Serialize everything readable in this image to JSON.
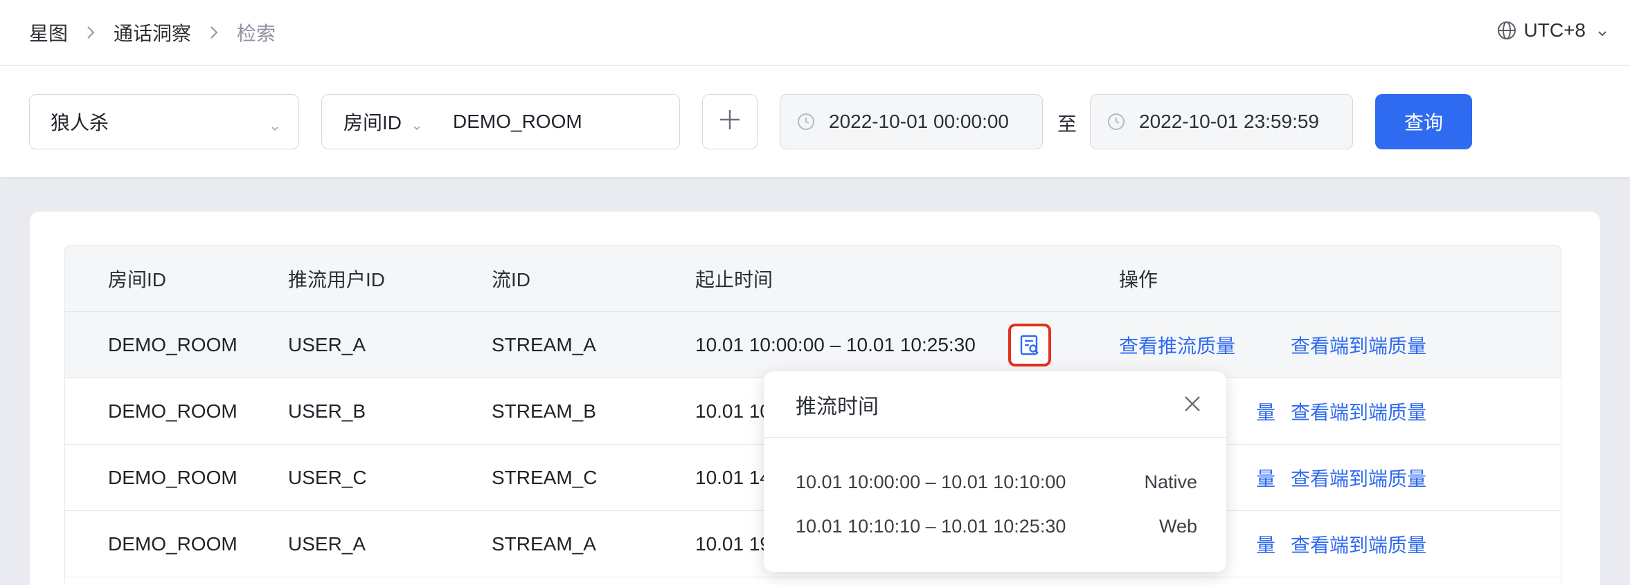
{
  "breadcrumb": [
    "星图",
    "通话洞察",
    "检索"
  ],
  "timezone": "UTC+8",
  "filters": {
    "app": "狼人杀",
    "room_key": "房间ID",
    "room_value": "DEMO_ROOM",
    "start_time": "2022-10-01 00:00:00",
    "to_label": "至",
    "end_time": "2022-10-01 23:59:59",
    "query_label": "查询"
  },
  "table": {
    "headers": [
      "房间ID",
      "推流用户ID",
      "流ID",
      "起止时间",
      "操作"
    ],
    "rows": [
      {
        "room": "DEMO_ROOM",
        "user": "USER_A",
        "stream": "STREAM_A",
        "time": "10.01 10:00:00 – 10.01 10:25:30",
        "action1": "查看推流质量",
        "action2": "查看端到端质量"
      },
      {
        "room": "DEMO_ROOM",
        "user": "USER_B",
        "stream": "STREAM_B",
        "time": "10.01 10",
        "action1": "量",
        "action2": "查看端到端质量"
      },
      {
        "room": "DEMO_ROOM",
        "user": "USER_C",
        "stream": "STREAM_C",
        "time": "10.01 14",
        "action1": "量",
        "action2": "查看端到端质量"
      },
      {
        "room": "DEMO_ROOM",
        "user": "USER_A",
        "stream": "STREAM_A",
        "time": "10.01 19",
        "action1": "量",
        "action2": "查看端到端质量"
      }
    ]
  },
  "popover": {
    "title": "推流时间",
    "items": [
      {
        "range": "10.01 10:00:00 – 10.01 10:10:00",
        "platform": "Native"
      },
      {
        "range": "10.01 10:10:10 – 10.01 10:25:30",
        "platform": "Web"
      }
    ]
  },
  "colors": {
    "accent": "#2f6bf0",
    "highlight_border": "#e0321f"
  }
}
